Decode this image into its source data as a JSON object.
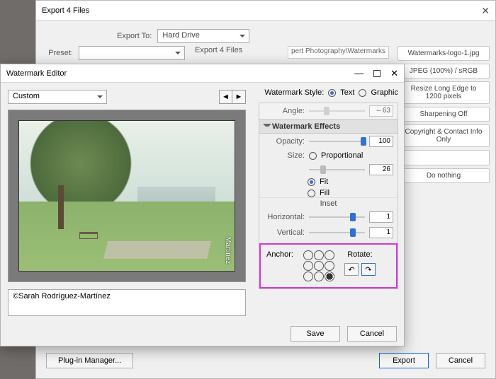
{
  "export": {
    "title": "Export 4 Files",
    "exportTo": {
      "label": "Export To:",
      "value": "Hard Drive"
    },
    "preset": {
      "label": "Preset:",
      "value": "Export 4 Files"
    },
    "pathTail": "pert Photography\\Watermarks",
    "chips": [
      "Watermarks-logo-1.jpg",
      "JPEG (100%) / sRGB",
      "Resize Long Edge to 1200 pixels",
      "Sharpening Off",
      "Copyright & Contact Info Only",
      "",
      "Do nothing"
    ],
    "pluginMgr": "Plug-in Manager...",
    "exportBtn": "Export",
    "cancelBtn": "Cancel"
  },
  "wm": {
    "title": "Watermark Editor",
    "preset": "Custom",
    "style": {
      "label": "Watermark Style:",
      "text": "Text",
      "graphic": "Graphic",
      "selected": "text"
    },
    "angle": {
      "label": "Angle:",
      "value": "– 63"
    },
    "effects": {
      "title": "Watermark Effects",
      "opacity": {
        "label": "Opacity:",
        "value": "100",
        "pos": 92
      },
      "size": {
        "label": "Size:",
        "proportional": "Proportional",
        "value": "26",
        "pos": 20,
        "fit": "Fit",
        "fill": "Fill",
        "selected": "fit"
      },
      "inset": {
        "title": "Inset",
        "horizontal": "Horizontal:",
        "hval": "1",
        "hpos": 74,
        "vertical": "Vertical:",
        "vval": "1",
        "vpos": 74
      },
      "anchor": {
        "label": "Anchor:",
        "selected": 8
      },
      "rotate": {
        "label": "Rotate:"
      }
    },
    "caption": "©Sarah Rodríguez-Martínez",
    "verticalMark": "Martinez",
    "save": "Save",
    "cancel": "Cancel"
  }
}
